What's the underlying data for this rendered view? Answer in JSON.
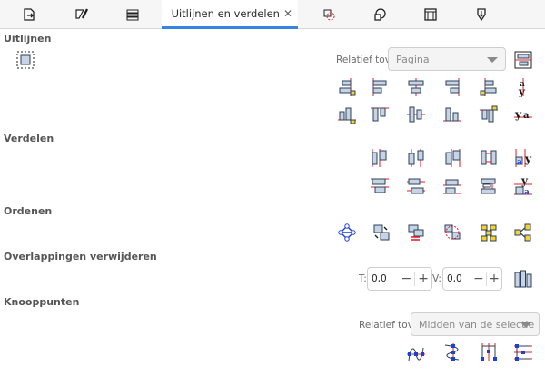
{
  "tabs": {
    "active_label": "Uitlijnen en verdelen"
  },
  "sections": {
    "align": "Uitlijnen",
    "distribute": "Verdelen",
    "arrange": "Ordenen",
    "remove_overlap": "Overlappingen verwijderen",
    "nodes": "Knooppunten"
  },
  "align": {
    "relative_label": "Relatief tov:",
    "relative_value": "Pagina"
  },
  "overlap": {
    "h_label": "T:",
    "h_value": "0,0",
    "v_label": "V:",
    "v_value": "0,0",
    "minus": "−",
    "plus": "+"
  },
  "nodes": {
    "relative_label": "Relatief tov:",
    "relative_value": "Midden van de selectie"
  },
  "colors": {
    "accent": "#3584e4",
    "guide_red": "#e01b24",
    "shape_fill": "#c6d4e6",
    "shape_stroke": "#2d3f57",
    "node_blue": "#1c3fd8",
    "highlight_yellow": "#f6d32d"
  }
}
